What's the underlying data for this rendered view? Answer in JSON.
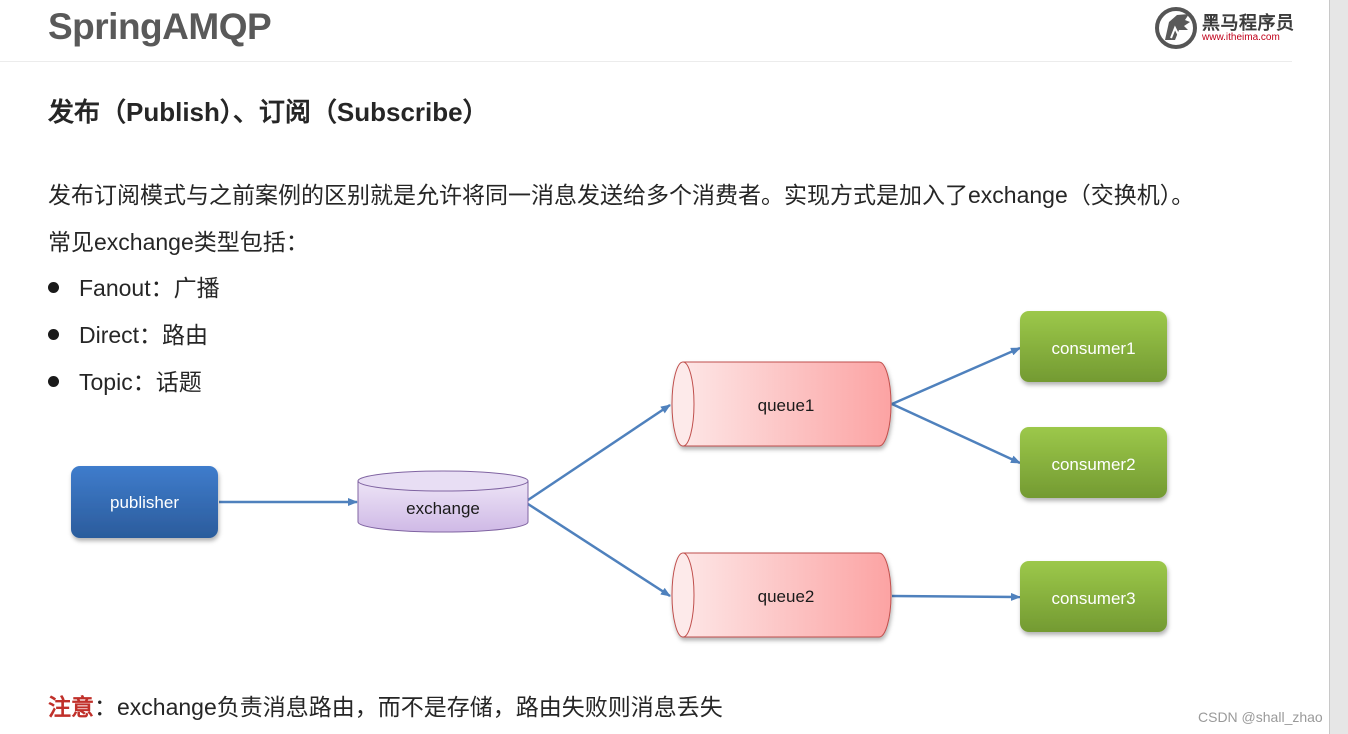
{
  "slide": {
    "title": "SpringAMQP",
    "logo": {
      "icon": "horse-head-logo-icon",
      "brand_cn": "黑马程序员",
      "url": "www.itheima.com"
    },
    "subtitle": "发布（Publish）、订阅（Subscribe）",
    "intro": "发布订阅模式与之前案例的区别就是允许将同一消息发送给多个消费者。实现方式是加入了exchange（交换机）。",
    "types_heading": "常见exchange类型包括：",
    "exchange_types": [
      {
        "label": "Fanout：广播"
      },
      {
        "label": "Direct：路由"
      },
      {
        "label": "Topic：话题"
      }
    ],
    "note": {
      "label": "注意",
      "text": "：exchange负责消息路由，而不是存储，路由失败则消息丢失"
    }
  },
  "diagram": {
    "nodes": {
      "publisher": {
        "label": "publisher",
        "shape": "rounded-rect",
        "color": "#3a72b8"
      },
      "exchange": {
        "label": "exchange",
        "shape": "cylinder",
        "color": "#d9c8ec"
      },
      "queue1": {
        "label": "queue1",
        "shape": "horizontal-cylinder",
        "color": "#fbb4b4"
      },
      "queue2": {
        "label": "queue2",
        "shape": "horizontal-cylinder",
        "color": "#fbb4b4"
      },
      "consumer1": {
        "label": "consumer1",
        "shape": "rounded-rect",
        "color": "#86b23e"
      },
      "consumer2": {
        "label": "consumer2",
        "shape": "rounded-rect",
        "color": "#86b23e"
      },
      "consumer3": {
        "label": "consumer3",
        "shape": "rounded-rect",
        "color": "#86b23e"
      }
    },
    "edges": [
      {
        "from": "publisher",
        "to": "exchange"
      },
      {
        "from": "exchange",
        "to": "queue1"
      },
      {
        "from": "exchange",
        "to": "queue2"
      },
      {
        "from": "queue1",
        "to": "consumer1"
      },
      {
        "from": "queue1",
        "to": "consumer2"
      },
      {
        "from": "queue2",
        "to": "consumer3"
      }
    ],
    "edge_color": "#4f81bd"
  },
  "watermark": "CSDN @shall_zhao"
}
